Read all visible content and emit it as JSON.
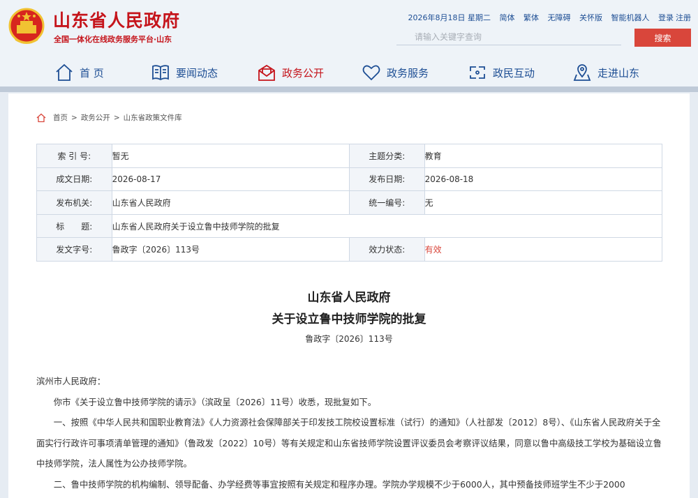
{
  "header": {
    "title": "山东省人民政府",
    "subtitle": "全国一体化在线政务服务平台·山东",
    "date": "2026年8月18日 星期二",
    "links": [
      "简体",
      "繁体",
      "无障碍",
      "关怀版",
      "智能机器人"
    ],
    "login": "登录",
    "register": "注册",
    "search_placeholder": "请输入关键字查询",
    "search_button": "搜索",
    "accent_color": "#c5141b"
  },
  "nav": [
    {
      "label": "首 页",
      "icon": "home-icon"
    },
    {
      "label": "要闻动态",
      "icon": "news-icon"
    },
    {
      "label": "政务公开",
      "icon": "mail-icon"
    },
    {
      "label": "政务服务",
      "icon": "heart-icon"
    },
    {
      "label": "政民互动",
      "icon": "interaction-icon"
    },
    {
      "label": "走进山东",
      "icon": "map-pin-icon"
    }
  ],
  "breadcrumb": [
    "首页",
    "政务公开",
    "山东省政策文件库"
  ],
  "meta": {
    "index_label": "索 引 号:",
    "index_value": "暂无",
    "topic_label": "主题分类:",
    "topic_value": "教育",
    "written_label": "成文日期:",
    "written_value": "2026-08-17",
    "published_label": "发布日期:",
    "published_value": "2026-08-18",
    "issuer_label": "发布机关:",
    "issuer_value": "山东省人民政府",
    "number_label": "统一编号:",
    "number_value": "无",
    "title_label": "标　　题:",
    "title_value": "山东省人民政府关于设立鲁中技师学院的批复",
    "docno_label": "发文字号:",
    "docno_value": "鲁政字〔2026〕113号",
    "status_label": "效力状态:",
    "status_value": "有效"
  },
  "document": {
    "title_line1": "山东省人民政府",
    "title_line2": "关于设立鲁中技师学院的批复",
    "number": "鲁政字〔2026〕113号",
    "salutation": "滨州市人民政府：",
    "para1": "你市《关于设立鲁中技师学院的请示》（滨政呈〔2026〕11号）收悉，现批复如下。",
    "para2": "一、按照《中华人民共和国职业教育法》《人力资源社会保障部关于印发技工院校设置标准（试行）的通知》（人社部发〔2012〕8号）、《山东省人民政府关于全面实行行政许可事项清单管理的通知》（鲁政发〔2022〕10号）等有关规定和山东省技师学院设置评议委员会考察评议结果，同意以鲁中高级技工学校为基础设立鲁中技师学院，法人属性为公办技师学院。",
    "para3": "二、鲁中技师学院的机构编制、领导配备、办学经费等事宜按照有关规定和程序办理。学院办学规模不少于6000人，其中预备技师班学生不少于2000"
  }
}
